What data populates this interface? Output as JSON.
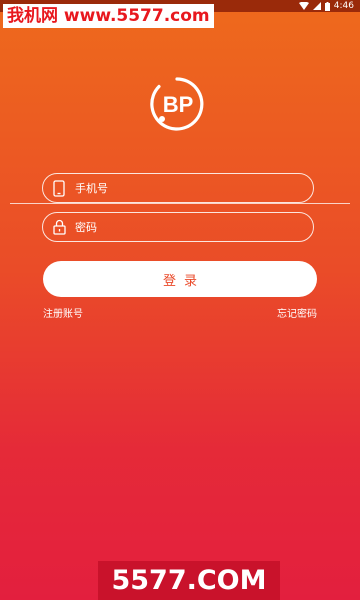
{
  "watermark_top": "我机网 www.5577.com",
  "status": {
    "time": "4:46"
  },
  "logo": {
    "text": "BP"
  },
  "phone_field": {
    "placeholder": "手机号"
  },
  "password_field": {
    "placeholder": "密码"
  },
  "login_button": {
    "label": "登录"
  },
  "register_link": "注册账号",
  "forgot_link": "忘记密码",
  "watermark_bottom": "5577.COM",
  "colors": {
    "gradient_top": "#ee6a1c",
    "gradient_bottom": "#e31f3e",
    "button_text": "#ea4a2a"
  }
}
